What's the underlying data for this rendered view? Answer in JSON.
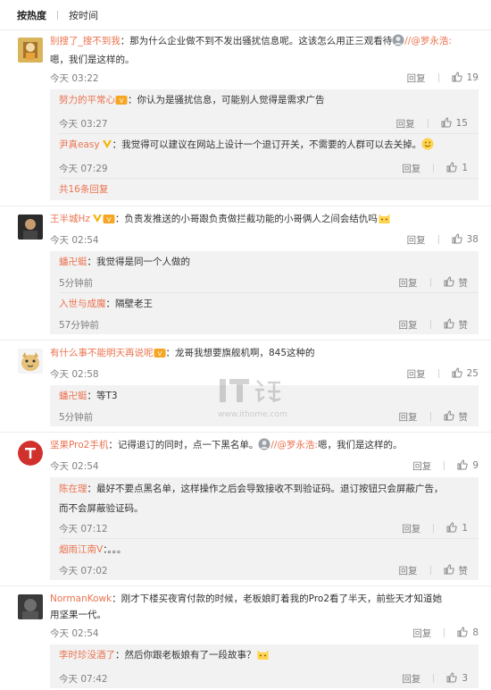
{
  "tabs": {
    "hot": "按热度",
    "time": "按时间"
  },
  "actions": {
    "reply": "回复",
    "like": "赞"
  },
  "watermark": {
    "site": "www.ithome.com"
  },
  "comments": [
    {
      "user": "别搜了_搜不到我",
      "text": "：那为什么企业做不到不发出骚扰信息呢。这该怎么用正三观看待",
      "mention": "//@罗永浩:",
      "text2": "嗯，我们是这样的。",
      "time": "今天 03:22",
      "likes": "19",
      "replies": [
        {
          "user": "努力的平常心",
          "text": "：你认为是骚扰信息，可能别人觉得是需求广告",
          "time": "今天 03:27",
          "likes": "15"
        },
        {
          "user": "尹真easy",
          "text": "：我觉得可以建议在网站上设计一个退订开关，不需要的人群可以去关掉。",
          "time": "今天 07:29",
          "likes": "1"
        }
      ],
      "more": "共16条回复"
    },
    {
      "user": "王半城Hz",
      "text": "：负责发推送的小哥跟负责做拦截功能的小哥俩人之间会结仇吗",
      "time": "今天 02:54",
      "likes": "38",
      "replies": [
        {
          "user": "蟠卍蜓",
          "text": "：我觉得是同一个人做的",
          "time": "5分钟前",
          "likes": "赞"
        },
        {
          "user": "入世与成魔",
          "text": "：隔壁老王",
          "time": "57分钟前",
          "likes": "赞"
        }
      ]
    },
    {
      "user": "有什么事不能明天再说呢",
      "text": "：龙哥我想要旗舰机啊，845这种的",
      "time": "今天 02:58",
      "likes": "25",
      "replies": [
        {
          "user": "蟠卍蜓",
          "text": "：等T3",
          "time": "5分钟前",
          "likes": "赞"
        }
      ]
    },
    {
      "user": "坚果Pro2手机",
      "text": "：记得退订的同时，点一下黑名单。",
      "mention": "//@罗永浩:",
      "text_after": "嗯，我们是这样的。",
      "time": "今天 02:54",
      "likes": "9",
      "replies": [
        {
          "user": "陈在理",
          "text": "：最好不要点黑名单，这样操作之后会导致接收不到验证码。退订按钮只会屏蔽广告，",
          "text2": "而不会屏蔽验证码。",
          "time": "今天 07:12",
          "likes": "1"
        },
        {
          "user": "烟雨江南V",
          "text": "：。。。",
          "time": "今天 07:02",
          "likes": "赞"
        }
      ]
    },
    {
      "user": "NormanKowk",
      "text": "：刚才下楼买夜宵付款的时候，老板娘盯着我的Pro2看了半天，前些天才知道她",
      "text2": "用坚果一代。",
      "time": "今天 02:54",
      "likes": "8",
      "replies": [
        {
          "user": "李时珍没酒了",
          "text": "：然后你跟老板娘有了一段故事？",
          "time": "今天 07:42",
          "likes": "3"
        }
      ]
    }
  ]
}
